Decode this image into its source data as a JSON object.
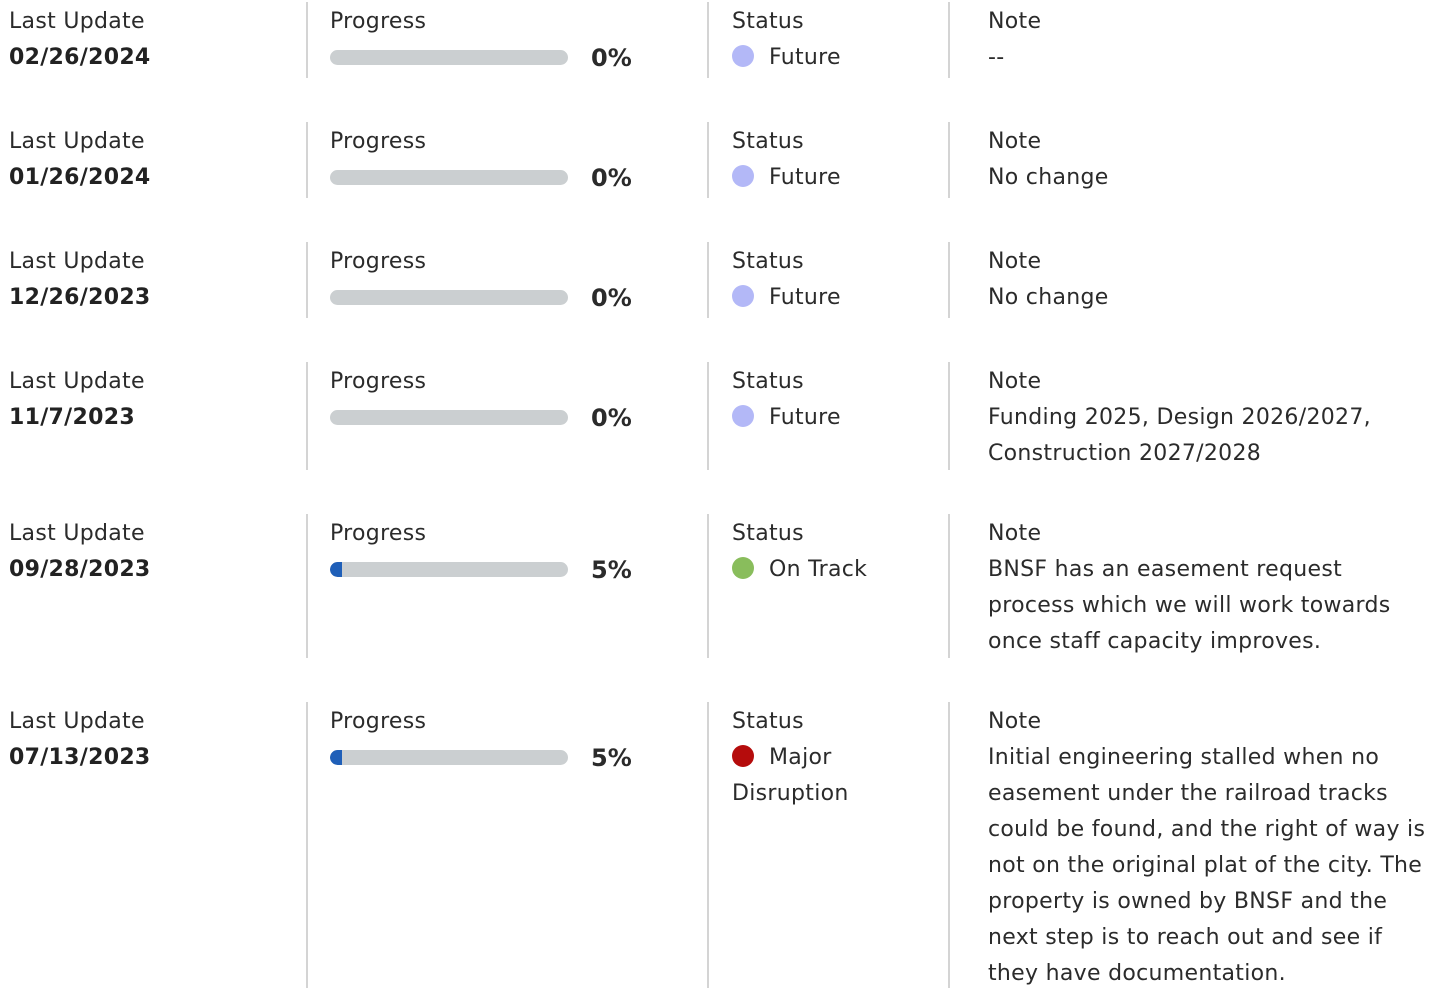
{
  "labels": {
    "last_update": "Last Update",
    "progress": "Progress",
    "status": "Status",
    "note": "Note"
  },
  "status_colors": {
    "Future": "#b3b8f7",
    "On Track": "#89bd5c",
    "Major Disruption": "#b50c0c"
  },
  "updates": [
    {
      "date": "02/26/2024",
      "progress_value": 0,
      "progress_text": "0%",
      "status": "Future",
      "note": "--"
    },
    {
      "date": "01/26/2024",
      "progress_value": 0,
      "progress_text": "0%",
      "status": "Future",
      "note": "No change"
    },
    {
      "date": "12/26/2023",
      "progress_value": 0,
      "progress_text": "0%",
      "status": "Future",
      "note": "No change"
    },
    {
      "date": "11/7/2023",
      "progress_value": 0,
      "progress_text": "0%",
      "status": "Future",
      "note": "Funding 2025, Design 2026/2027, Construction 2027/2028"
    },
    {
      "date": "09/28/2023",
      "progress_value": 5,
      "progress_text": "5%",
      "status": "On Track",
      "note": "BNSF has an easement request process which we will work towards once staff capacity improves."
    },
    {
      "date": "07/13/2023",
      "progress_value": 5,
      "progress_text": "5%",
      "status": "Major Disruption",
      "note": "Initial engineering stalled when no easement under the railroad tracks could be found, and the right of way is not on the original plat of the city. The property is owned by BNSF and the next step is to reach out and see if they have documentation."
    }
  ]
}
